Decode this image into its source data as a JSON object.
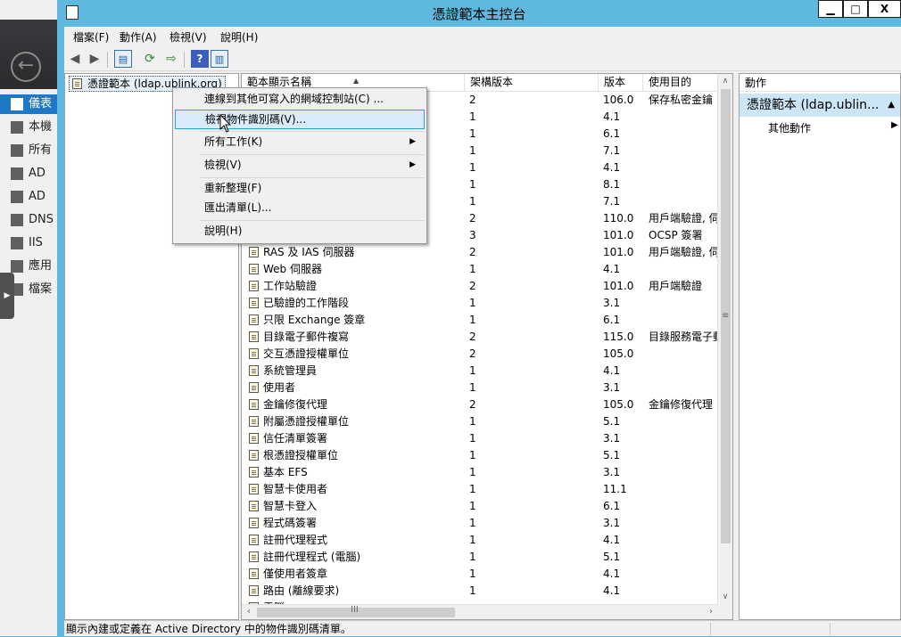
{
  "background": {
    "nav_items": [
      {
        "label": "儀表",
        "active": true
      },
      {
        "label": "本機"
      },
      {
        "label": "所有"
      },
      {
        "label": "AD"
      },
      {
        "label": "AD"
      },
      {
        "label": "DNS"
      },
      {
        "label": "IIS"
      },
      {
        "label": "應用"
      },
      {
        "label": "檔案"
      }
    ]
  },
  "window": {
    "title": "憑證範本主控台",
    "min_label": "▁",
    "max_label": "□",
    "close_label": "X"
  },
  "menubar": {
    "items": [
      "檔案(F)",
      "動作(A)",
      "檢視(V)",
      "說明(H)"
    ]
  },
  "toolbar": {
    "back_icon": "◀",
    "forward_icon": "▶",
    "help_label": "?"
  },
  "tree": {
    "root_label": "憑證範本 (ldap.ublink.org)"
  },
  "list": {
    "columns": [
      "範本顯示名稱",
      "架構版本",
      "版本",
      "使用目的"
    ],
    "rows": [
      {
        "name": "",
        "schema": "2",
        "version": "106.0",
        "purpose": "保存私密金鑰"
      },
      {
        "name": "",
        "schema": "1",
        "version": "4.1",
        "purpose": ""
      },
      {
        "name": "",
        "schema": "1",
        "version": "6.1",
        "purpose": ""
      },
      {
        "name": "",
        "schema": "1",
        "version": "7.1",
        "purpose": ""
      },
      {
        "name": ")",
        "schema": "1",
        "version": "4.1",
        "purpose": ""
      },
      {
        "name": "",
        "schema": "1",
        "version": "8.1",
        "purpose": ""
      },
      {
        "name": "",
        "schema": "1",
        "version": "7.1",
        "purpose": ""
      },
      {
        "name": "",
        "schema": "2",
        "version": "110.0",
        "purpose": "用戶端驗證, 伺"
      },
      {
        "name": "",
        "schema": "3",
        "version": "101.0",
        "purpose": "OCSP 簽署"
      },
      {
        "name": "RAS 及 IAS 伺服器",
        "schema": "2",
        "version": "101.0",
        "purpose": "用戶端驗證, 伺"
      },
      {
        "name": "Web 伺服器",
        "schema": "1",
        "version": "4.1",
        "purpose": ""
      },
      {
        "name": "工作站驗證",
        "schema": "2",
        "version": "101.0",
        "purpose": "用戶端驗證"
      },
      {
        "name": "已驗證的工作階段",
        "schema": "1",
        "version": "3.1",
        "purpose": ""
      },
      {
        "name": "只限 Exchange 簽章",
        "schema": "1",
        "version": "6.1",
        "purpose": ""
      },
      {
        "name": "目錄電子郵件複寫",
        "schema": "2",
        "version": "115.0",
        "purpose": "目錄服務電子郵"
      },
      {
        "name": "交互憑證授權單位",
        "schema": "2",
        "version": "105.0",
        "purpose": ""
      },
      {
        "name": "系統管理員",
        "schema": "1",
        "version": "4.1",
        "purpose": ""
      },
      {
        "name": "使用者",
        "schema": "1",
        "version": "3.1",
        "purpose": ""
      },
      {
        "name": "金鑰修復代理",
        "schema": "2",
        "version": "105.0",
        "purpose": "金鑰修復代理"
      },
      {
        "name": "附屬憑證授權單位",
        "schema": "1",
        "version": "5.1",
        "purpose": ""
      },
      {
        "name": "信任清單簽署",
        "schema": "1",
        "version": "3.1",
        "purpose": ""
      },
      {
        "name": "根憑證授權單位",
        "schema": "1",
        "version": "5.1",
        "purpose": ""
      },
      {
        "name": "基本 EFS",
        "schema": "1",
        "version": "3.1",
        "purpose": ""
      },
      {
        "name": "智慧卡使用者",
        "schema": "1",
        "version": "11.1",
        "purpose": ""
      },
      {
        "name": "智慧卡登入",
        "schema": "1",
        "version": "6.1",
        "purpose": ""
      },
      {
        "name": "程式碼簽署",
        "schema": "1",
        "version": "3.1",
        "purpose": ""
      },
      {
        "name": "註冊代理程式",
        "schema": "1",
        "version": "4.1",
        "purpose": ""
      },
      {
        "name": "註冊代理程式 (電腦)",
        "schema": "1",
        "version": "5.1",
        "purpose": ""
      },
      {
        "name": "僅使用者簽章",
        "schema": "1",
        "version": "4.1",
        "purpose": ""
      },
      {
        "name": "路由 (離線要求)",
        "schema": "1",
        "version": "4.1",
        "purpose": ""
      },
      {
        "name": "電腦",
        "schema": "",
        "version": "",
        "purpose": ""
      }
    ]
  },
  "actions": {
    "header": "動作",
    "section_title": "憑證範本 (ldap.ublin...",
    "other_actions": "其他動作"
  },
  "context_menu": {
    "items": [
      {
        "label": "連線到其他可寫入的網域控制站(C) ..."
      },
      {
        "label": "檢視物件識別碼(V)...",
        "highlighted": true
      },
      {
        "label": "所有工作(K)",
        "submenu": true
      },
      {
        "label": "檢視(V)",
        "submenu": true
      },
      {
        "label": "重新整理(F)"
      },
      {
        "label": "匯出清單(L)..."
      },
      {
        "label": "說明(H)"
      }
    ]
  },
  "status": {
    "text": "顯示內建或定義在 Active Directory 中的物件識別碼清單。"
  }
}
